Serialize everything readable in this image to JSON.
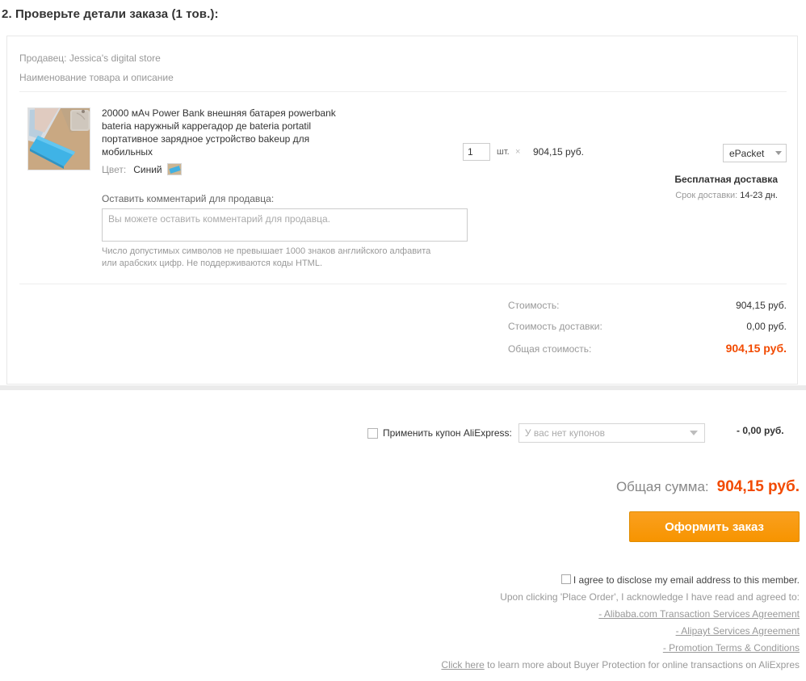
{
  "heading": "2. Проверьте детали заказа (1 тов.):",
  "card": {
    "seller_line": "Продавец: Jessica's digital store",
    "column_header": "Наименование товара и описание",
    "product": {
      "title": "20000 мАч Power Bank внешняя батарея powerbank bateria наружный каррегадор де bateria portatil портативное зарядное устройство bakeup для мобильных",
      "color_label": "Цвет:",
      "color_value": "Синий",
      "image_alt": "blue-power-bank-on-desk"
    },
    "quantity": {
      "value": "1",
      "unit": "шт.",
      "times": "×",
      "unit_price": "904,15 руб."
    },
    "shipping": {
      "method": "ePacket",
      "free_label": "Бесплатная доставка",
      "time_label": "Срок доставки:",
      "time_value": "14-23 дн."
    },
    "comment": {
      "label": "Оставить комментарий для продавца:",
      "placeholder": "Вы можете оставить комментарий для продавца.",
      "value": "",
      "note": "Число допустимых символов не превышает 1000 знаков английского алфавита или арабских цифр. Не поддерживаются коды HTML."
    },
    "totals": [
      {
        "label": "Стоимость:",
        "value": "904,15 руб."
      },
      {
        "label": "Стоимость доставки:",
        "value": "0,00 руб."
      },
      {
        "label": "Общая стоимость:",
        "value": "904,15 руб."
      }
    ]
  },
  "coupon": {
    "checkbox_label": "Применить купон AliExpress:",
    "select_value": "У вас нет купонов",
    "amount": "- 0,00 руб.",
    "checked": false
  },
  "grand_total": {
    "label": "Общая сумма:",
    "value": "904,15 руб."
  },
  "place_order_button": "Оформить заказ",
  "footer": {
    "email_agree": "I agree to disclose my email address to this member.",
    "acknowledge": "Upon clicking 'Place Order', I acknowledge I have read and agreed to:",
    "links": [
      "- Alibaba.com Transaction Services Agreement",
      "- Alipayt Services Agreement",
      "- Promotion Terms & Conditions"
    ],
    "buyer_protection_link": "Click here",
    "buyer_protection_tail": " to learn more about Buyer Protection for online transactions on AliExpres"
  },
  "colors": {
    "accent_orange": "#f24a00",
    "button_orange": "#f79400",
    "muted_text": "#999999"
  }
}
